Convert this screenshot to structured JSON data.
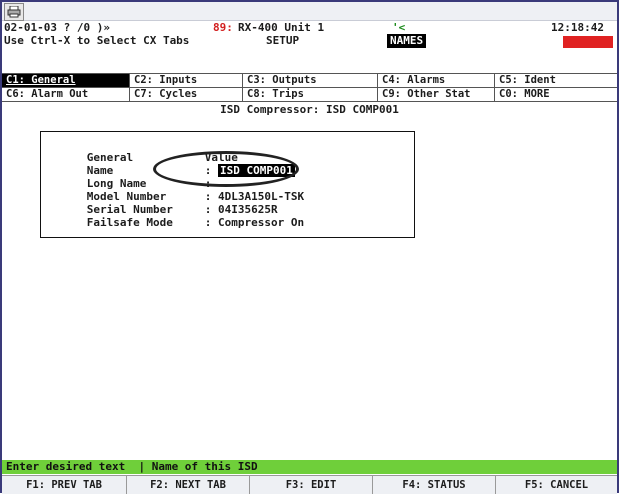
{
  "header": {
    "datecode": "02-01-03 ? /0 )»",
    "code": "89:",
    "unit": "RX-400 Unit 1",
    "signal": "'<",
    "time": "12:18:42",
    "instruction": "Use Ctrl-X to Select CX Tabs",
    "mode": "SETUP",
    "names_badge": "NAMES"
  },
  "tabs_row1": [
    "C1: General",
    "C2: Inputs",
    "C3: Outputs",
    "C4: Alarms",
    "C5: Ident"
  ],
  "tabs_row2": [
    "C6: Alarm Out",
    "C7: Cycles",
    "C8: Trips",
    "C9: Other Stat",
    "C0: MORE"
  ],
  "page_title": "ISD Compressor: ISD COMP001",
  "form": {
    "header_label": "General",
    "header_value": "Value",
    "rows": [
      {
        "label": "Name",
        "sep": ":",
        "value": "ISD COMP001"
      },
      {
        "label": "Long Name",
        "sep": ":",
        "value": ""
      },
      {
        "label": "Model Number",
        "sep": ":",
        "value": "4DL3A150L-TSK"
      },
      {
        "label": "Serial Number",
        "sep": ":",
        "value": "04I35625R"
      },
      {
        "label": "Failsafe Mode",
        "sep": ":",
        "value": "Compressor On"
      }
    ]
  },
  "status": "Enter desired text  | Name of this ISD",
  "fkeys": [
    "F1: PREV TAB",
    "F2: NEXT TAB",
    "F3: EDIT",
    "F4: STATUS",
    "F5: CANCEL"
  ],
  "colors": {
    "status_bg": "#6fcf3a",
    "alert": "#e02222",
    "highlight": "#000000"
  }
}
